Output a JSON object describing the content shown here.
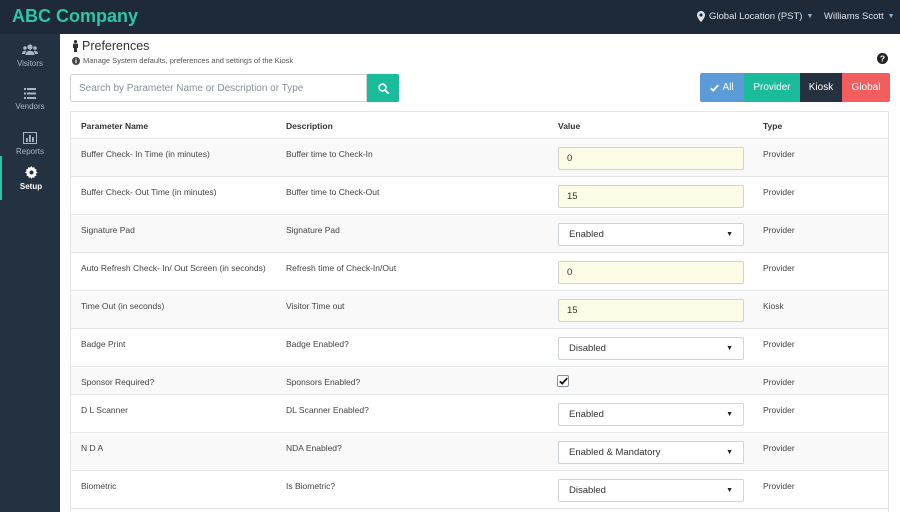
{
  "app": {
    "brand": "ABC Company",
    "location": "Global Location (PST)",
    "user": "Williams Scott"
  },
  "sidebar": {
    "items": [
      {
        "label": "Visitors",
        "icon": "users-icon",
        "active": false
      },
      {
        "label": "Vendors",
        "icon": "list-icon",
        "active": false
      },
      {
        "label": "Reports",
        "icon": "bar-chart-icon",
        "active": false
      },
      {
        "label": "Setup",
        "icon": "gear-icon",
        "active": true
      }
    ]
  },
  "page": {
    "title": "Preferences",
    "subtitle": "Manage System defaults, preferences and settings of the Kiosk"
  },
  "search": {
    "placeholder": "Search by Parameter Name or Description or Type"
  },
  "filters": {
    "all": "All",
    "provider": "Provider",
    "kiosk": "Kiosk",
    "global": "Global"
  },
  "table": {
    "headers": {
      "name": "Parameter Name",
      "description": "Description",
      "value": "Value",
      "type": "Type"
    },
    "rows": [
      {
        "name": "Buffer Check- In Time (in minutes)",
        "description": "Buffer time to Check-In",
        "control": "input",
        "value": "0",
        "type": "Provider"
      },
      {
        "name": "Buffer Check- Out Time (in minutes)",
        "description": "Buffer time to Check-Out",
        "control": "input",
        "value": "15",
        "type": "Provider"
      },
      {
        "name": "Signature Pad",
        "description": "Signature Pad",
        "control": "select",
        "value": "Enabled",
        "type": "Provider"
      },
      {
        "name": "Auto Refresh Check- In/ Out Screen (in seconds)",
        "description": "Refresh time of Check-In/Out",
        "control": "input",
        "value": "0",
        "type": "Provider"
      },
      {
        "name": "Time Out (in seconds)",
        "description": "Visitor Time out",
        "control": "input",
        "value": "15",
        "type": "Kiosk"
      },
      {
        "name": "Badge Print",
        "description": "Badge Enabled?",
        "control": "select",
        "value": "Disabled",
        "type": "Provider"
      },
      {
        "name": "Sponsor Required?",
        "description": "Sponsors Enabled?",
        "control": "checkbox",
        "value": true,
        "type": "Provider"
      },
      {
        "name": "D L Scanner",
        "description": "DL Scanner Enabled?",
        "control": "select",
        "value": "Enabled",
        "type": "Provider"
      },
      {
        "name": "N D A",
        "description": "NDA Enabled?",
        "control": "select",
        "value": "Enabled & Mandatory",
        "type": "Provider"
      },
      {
        "name": "Biometric",
        "description": "Is Biometric?",
        "control": "select",
        "value": "Disabled",
        "type": "Provider"
      }
    ]
  },
  "colors": {
    "accent": "#1abc9c",
    "topbar": "#1f2a38",
    "sidebar": "#243140",
    "all_button": "#5b9bd8",
    "global_button": "#f25e5e"
  }
}
